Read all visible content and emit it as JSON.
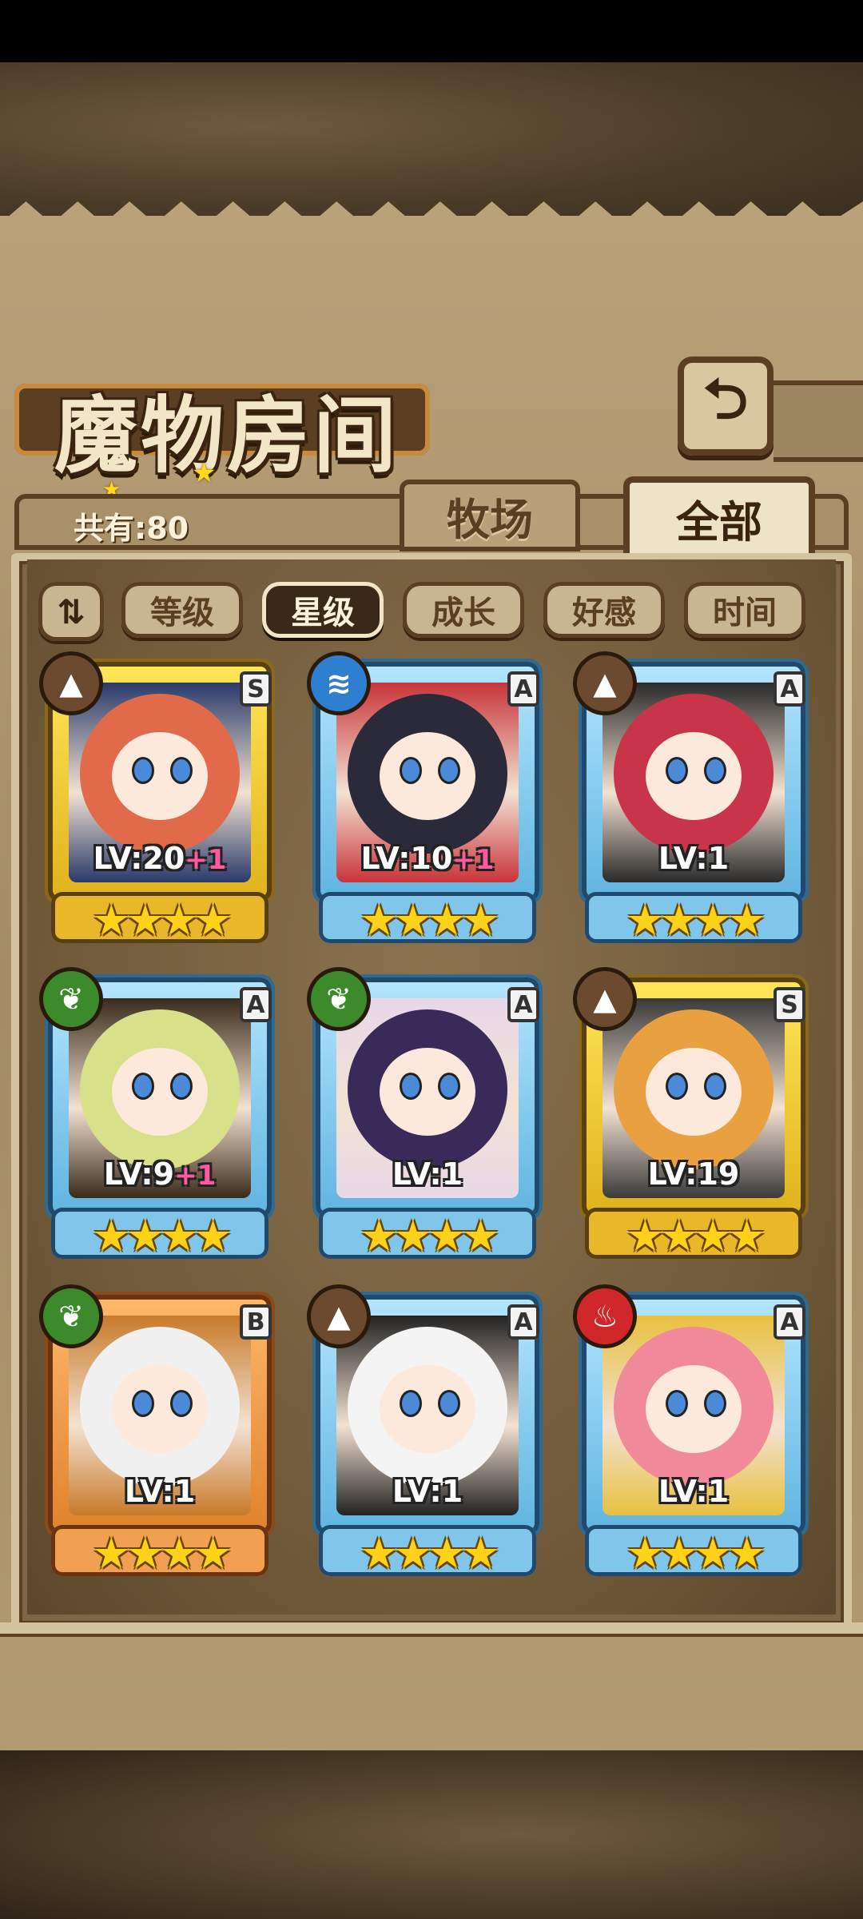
{
  "header": {
    "title": "魔物房间",
    "back_icon": "back-arrow-icon"
  },
  "tabs": {
    "count_label": "共有:80",
    "ranch": "牧场",
    "all": "全部",
    "active": "全部"
  },
  "filters": {
    "sort_icon": "sort-icon",
    "items": [
      "等级",
      "星级",
      "成长",
      "好感",
      "时间"
    ],
    "active": "星级"
  },
  "monsters": [
    {
      "level": "LV:20",
      "bonus": "+1",
      "rank": "S",
      "element": "earth",
      "stars": 4,
      "frame": "gold",
      "hair": "#e06a4a",
      "accent": "#2a3a6a"
    },
    {
      "level": "LV:10",
      "bonus": "+1",
      "rank": "A",
      "element": "water",
      "stars": 4,
      "frame": "blue",
      "hair": "#2a2a3a",
      "accent": "#c8343a"
    },
    {
      "level": "LV:1",
      "bonus": "",
      "rank": "A",
      "element": "earth",
      "stars": 4,
      "frame": "blue",
      "hair": "#c8344a",
      "accent": "#2a2a2a"
    },
    {
      "level": "LV:9",
      "bonus": "+1",
      "rank": "A",
      "element": "grass",
      "stars": 4,
      "frame": "blue",
      "hair": "#d8e08a",
      "accent": "#3a2a1a"
    },
    {
      "level": "LV:1",
      "bonus": "",
      "rank": "A",
      "element": "grass",
      "stars": 4,
      "frame": "blue",
      "hair": "#3a2a5a",
      "accent": "#e8d8e8"
    },
    {
      "level": "LV:19",
      "bonus": "",
      "rank": "S",
      "element": "earth",
      "stars": 4,
      "frame": "gold",
      "hair": "#e8a040",
      "accent": "#3a3a3a"
    },
    {
      "level": "LV:1",
      "bonus": "",
      "rank": "B",
      "element": "grass",
      "stars": 4,
      "frame": "orange",
      "hair": "#f0f0f0",
      "accent": "#c87a2a"
    },
    {
      "level": "LV:1",
      "bonus": "",
      "rank": "A",
      "element": "earth",
      "stars": 4,
      "frame": "blue",
      "hair": "#f4f4f4",
      "accent": "#222222"
    },
    {
      "level": "LV:1",
      "bonus": "",
      "rank": "A",
      "element": "fire",
      "stars": 4,
      "frame": "blue",
      "hair": "#f08a9a",
      "accent": "#e8c040"
    }
  ],
  "colors": {
    "parchment": "#b9a27a",
    "panel": "#7d6646",
    "star": "#ffd21a"
  }
}
